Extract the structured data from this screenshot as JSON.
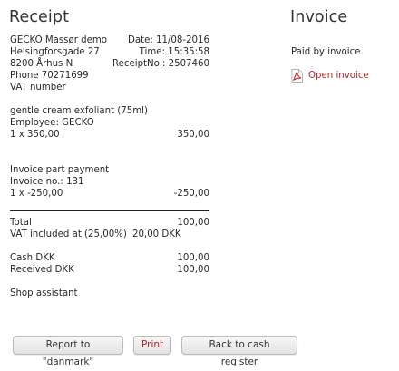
{
  "receipt": {
    "title": "Receipt",
    "store": {
      "name": "GECKO Massør demo",
      "street": "Helsingforsgade 27",
      "city": "8200 Århus N",
      "phone": "Phone 70271699",
      "vat": "VAT number"
    },
    "meta": {
      "date": "Date: 11/08-2016",
      "time": "Time: 15:35:58",
      "receipt_no": "ReceiptNo.: 2507460"
    },
    "item": {
      "name": "gentle cream exfoliant (75ml)",
      "employee": "Employee: GECKO",
      "qty_price": "1 x 350,00",
      "amount": "350,00"
    },
    "invoice_part": {
      "label": "Invoice part payment",
      "invoice_no": "Invoice no.: 131",
      "qty_price": "1 x -250,00",
      "amount": "-250,00"
    },
    "total_label": "Total",
    "total_value": "100,00",
    "vat_line": "VAT included at (25,00%)",
    "vat_value": "20,00 DKK",
    "cash_label": "Cash DKK",
    "cash_value": "100,00",
    "received_label": "Received DKK",
    "received_value": "100,00",
    "shop_assistant": "Shop assistant"
  },
  "invoice": {
    "title": "Invoice",
    "paid_text": "Paid by invoice.",
    "open_link": "Open invoice",
    "icon": "pdf-icon"
  },
  "buttons": {
    "report": "Report to \"danmark\"",
    "print": "Print",
    "back": "Back to cash register"
  },
  "colors": {
    "link": "#b0242a",
    "pdf_icon": "#d32f2f"
  }
}
